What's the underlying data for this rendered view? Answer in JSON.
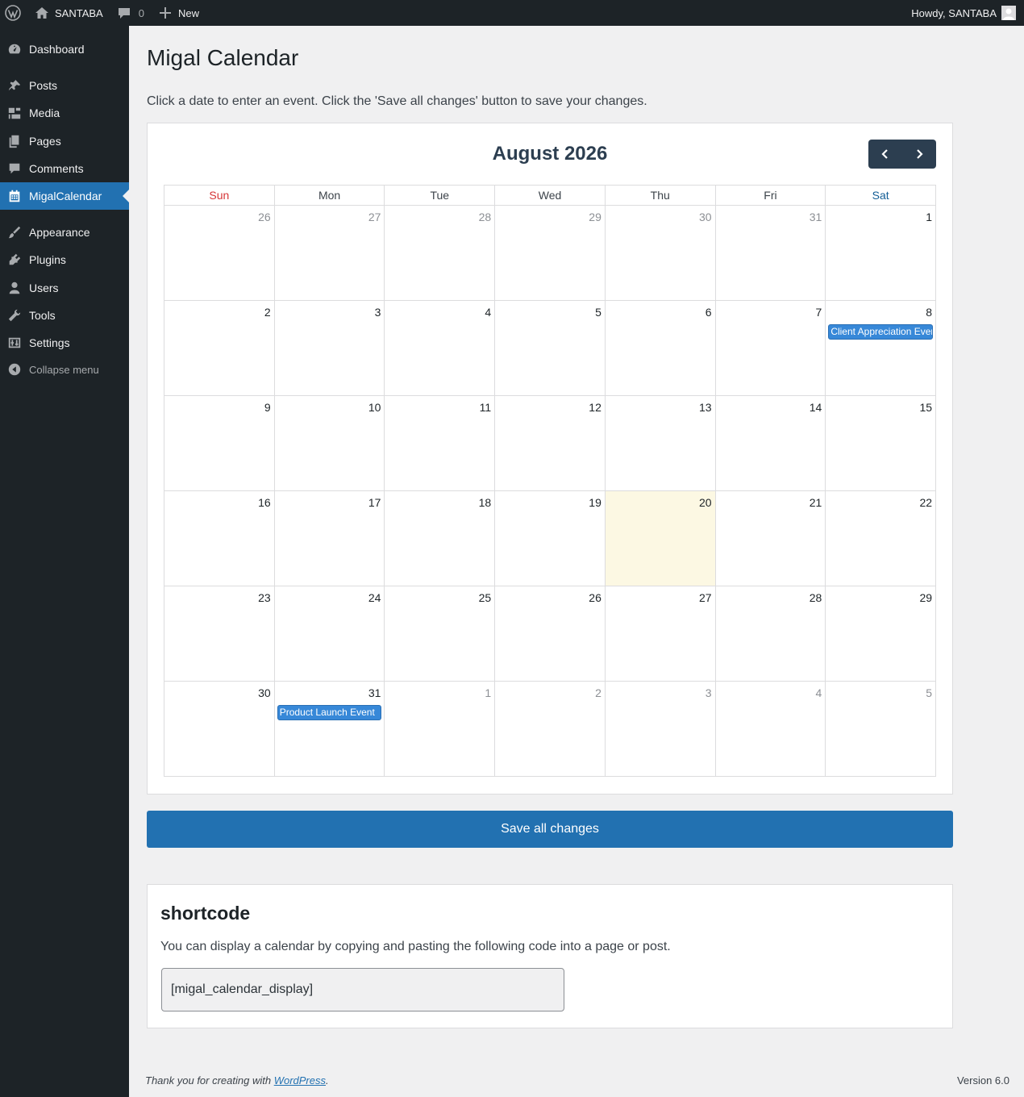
{
  "adminbar": {
    "site_name": "SANTABA",
    "comments_count": "0",
    "new_label": "New",
    "howdy": "Howdy, SANTABA"
  },
  "sidebar": {
    "items": [
      {
        "label": "Dashboard",
        "icon": "dashboard-icon"
      },
      {
        "label": "Posts",
        "icon": "pin-icon"
      },
      {
        "label": "Media",
        "icon": "media-icon"
      },
      {
        "label": "Pages",
        "icon": "pages-icon"
      },
      {
        "label": "Comments",
        "icon": "comment-icon"
      },
      {
        "label": "MigalCalendar",
        "icon": "calendar-icon",
        "current": true
      },
      {
        "label": "Appearance",
        "icon": "brush-icon"
      },
      {
        "label": "Plugins",
        "icon": "plugin-icon"
      },
      {
        "label": "Users",
        "icon": "user-icon"
      },
      {
        "label": "Tools",
        "icon": "wrench-icon"
      },
      {
        "label": "Settings",
        "icon": "settings-icon"
      }
    ],
    "collapse_label": "Collapse menu"
  },
  "page": {
    "title": "Migal Calendar",
    "intro": "Click a date to enter an event. Click the 'Save all changes' button to save your changes."
  },
  "calendar": {
    "month_title": "August 2026",
    "weekdays": [
      "Sun",
      "Mon",
      "Tue",
      "Wed",
      "Thu",
      "Fri",
      "Sat"
    ],
    "weeks": [
      [
        {
          "d": "26",
          "other": true
        },
        {
          "d": "27",
          "other": true
        },
        {
          "d": "28",
          "other": true
        },
        {
          "d": "29",
          "other": true
        },
        {
          "d": "30",
          "other": true
        },
        {
          "d": "31",
          "other": true
        },
        {
          "d": "1"
        }
      ],
      [
        {
          "d": "2"
        },
        {
          "d": "3"
        },
        {
          "d": "4"
        },
        {
          "d": "5"
        },
        {
          "d": "6"
        },
        {
          "d": "7"
        },
        {
          "d": "8",
          "event": "Client Appreciation Event"
        }
      ],
      [
        {
          "d": "9"
        },
        {
          "d": "10"
        },
        {
          "d": "11"
        },
        {
          "d": "12"
        },
        {
          "d": "13"
        },
        {
          "d": "14"
        },
        {
          "d": "15"
        }
      ],
      [
        {
          "d": "16"
        },
        {
          "d": "17"
        },
        {
          "d": "18"
        },
        {
          "d": "19"
        },
        {
          "d": "20",
          "today": true
        },
        {
          "d": "21"
        },
        {
          "d": "22"
        }
      ],
      [
        {
          "d": "23"
        },
        {
          "d": "24"
        },
        {
          "d": "25"
        },
        {
          "d": "26"
        },
        {
          "d": "27"
        },
        {
          "d": "28"
        },
        {
          "d": "29"
        }
      ],
      [
        {
          "d": "30"
        },
        {
          "d": "31",
          "event": "Product Launch Event"
        },
        {
          "d": "1",
          "other": true
        },
        {
          "d": "2",
          "other": true
        },
        {
          "d": "3",
          "other": true
        },
        {
          "d": "4",
          "other": true
        },
        {
          "d": "5",
          "other": true
        }
      ]
    ],
    "colors": {
      "event": "#3788d8",
      "today": "#fcf8e3",
      "sunday": "#d63638",
      "saturday": "#135e96"
    }
  },
  "save_button": "Save all changes",
  "shortcode": {
    "title": "shortcode",
    "description": "You can display a calendar by copying and pasting the following code into a page or post.",
    "code": "[migal_calendar_display]"
  },
  "footer": {
    "thanks_prefix": "Thank you for creating with ",
    "thanks_link": "WordPress",
    "thanks_suffix": ".",
    "version": "Version 6.0"
  }
}
